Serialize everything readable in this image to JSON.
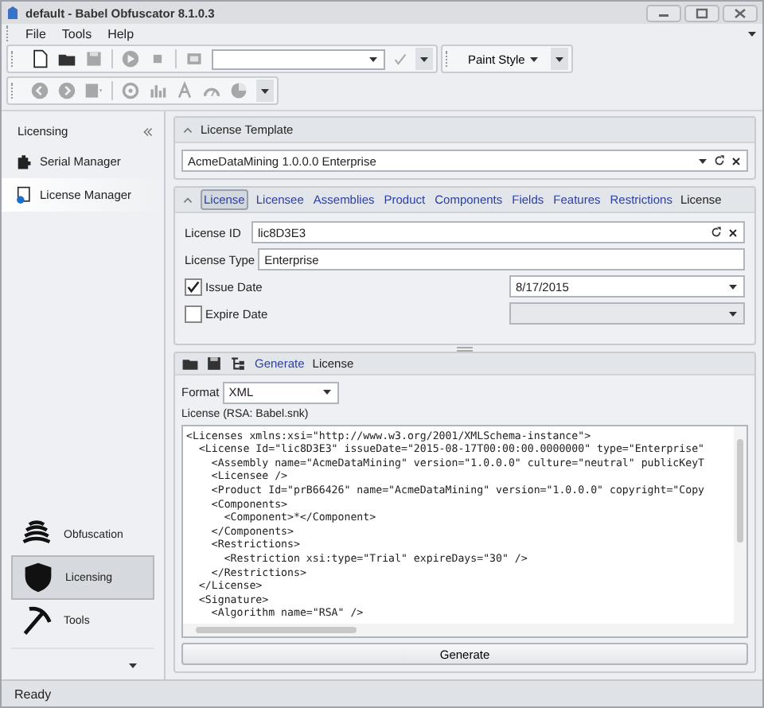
{
  "window": {
    "title": "default - Babel Obfuscator 8.1.0.3"
  },
  "menu": [
    "File",
    "Tools",
    "Help"
  ],
  "toolbar_1": {
    "tools": [
      {
        "kind": "new",
        "disabled": false
      },
      {
        "kind": "open",
        "disabled": false
      },
      {
        "kind": "save",
        "disabled": true
      },
      {
        "kind": "sep"
      },
      {
        "kind": "play",
        "disabled": true
      },
      {
        "kind": "stop",
        "disabled": true
      },
      {
        "kind": "sep"
      },
      {
        "kind": "build",
        "disabled": true
      }
    ],
    "check_disabled": true,
    "paint_style": "Paint Style"
  },
  "toolbar_2": {
    "tools": [
      {
        "kind": "back",
        "disabled": true
      },
      {
        "kind": "forward",
        "disabled": true
      },
      {
        "kind": "grid",
        "disabled": true
      },
      {
        "kind": "sep"
      },
      {
        "kind": "target",
        "disabled": true
      },
      {
        "kind": "chart",
        "disabled": true
      },
      {
        "kind": "font",
        "disabled": true
      },
      {
        "kind": "gauge",
        "disabled": true
      },
      {
        "kind": "pie",
        "disabled": true
      }
    ]
  },
  "sidebar": {
    "title": "Licensing",
    "items": [
      {
        "label": "Serial Manager",
        "selected": false
      },
      {
        "label": "License Manager",
        "selected": true
      }
    ],
    "nav": [
      {
        "label": "Obfuscation",
        "selected": false
      },
      {
        "label": "Licensing",
        "selected": true
      },
      {
        "label": "Tools",
        "selected": false
      }
    ]
  },
  "license_template": {
    "title": "License Template",
    "value": "AcmeDataMining 1.0.0.0 Enterprise"
  },
  "license_editor": {
    "tabs": [
      {
        "label": "License",
        "selected": true
      },
      {
        "label": "Licensee",
        "selected": false
      },
      {
        "label": "Assemblies",
        "selected": false
      },
      {
        "label": "Product",
        "selected": false
      },
      {
        "label": "Components",
        "selected": false
      },
      {
        "label": "Fields",
        "selected": false
      },
      {
        "label": "Features",
        "selected": false
      },
      {
        "label": "Restrictions",
        "selected": false
      }
    ],
    "caption": "License",
    "license_id": {
      "label": "License ID",
      "value": "lic8D3E3"
    },
    "license_type": {
      "label": "License Type",
      "value": "Enterprise"
    },
    "issue_date": {
      "label": "Issue Date",
      "checked": true,
      "value": "8/17/2015"
    },
    "expire_date": {
      "label": "Expire Date",
      "checked": false
    }
  },
  "generator": {
    "link": "Generate",
    "caption": "License",
    "format_label": "Format",
    "format": "XML",
    "output_label": "License (RSA: Babel.snk)",
    "lines": [
      "<Licenses xmlns:xsi=\"http://www.w3.org/2001/XMLSchema-instance\">",
      "  <License Id=\"lic8D3E3\" issueDate=\"2015-08-17T00:00:00.0000000\" type=\"Enterprise\"",
      "    <Assembly name=\"AcmeDataMining\" version=\"1.0.0.0\" culture=\"neutral\" publicKeyT",
      "    <Licensee />",
      "    <Product Id=\"prB66426\" name=\"AcmeDataMining\" version=\"1.0.0.0\" copyright=\"Copy",
      "    <Components>",
      "      <Component>*</Component>",
      "    </Components>",
      "    <Restrictions>",
      "      <Restriction xsi:type=\"Trial\" expireDays=\"30\" />",
      "    </Restrictions>",
      "  </License>",
      "  <Signature>",
      "    <Algorithm name=\"RSA\" />"
    ],
    "button": "Generate"
  },
  "status_bar": "Ready"
}
